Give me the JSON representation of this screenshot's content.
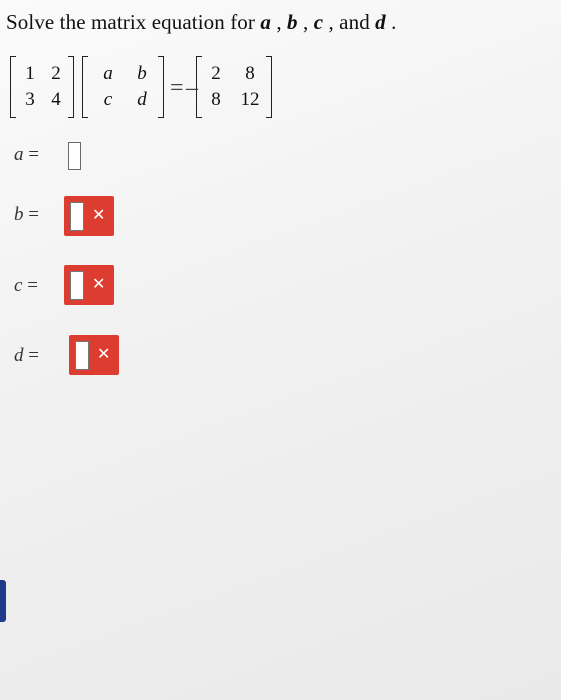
{
  "question": {
    "prefix": "Solve the matrix equation for ",
    "var_a": "a",
    "sep1": " , ",
    "var_b": "b",
    "sep2": " , ",
    "var_c": "c",
    "sep3": " , and ",
    "var_d": "d",
    "suffix": " ."
  },
  "equation": {
    "matrix_a": [
      [
        "1",
        "2"
      ],
      [
        "3",
        "4"
      ]
    ],
    "matrix_x": [
      [
        "a",
        "b"
      ],
      [
        "c",
        "d"
      ]
    ],
    "equals": "=",
    "minus": "–",
    "matrix_result": [
      [
        "2",
        "8"
      ],
      [
        "8",
        "12"
      ]
    ]
  },
  "answers": [
    {
      "var": "a",
      "eq": " =",
      "status": "empty"
    },
    {
      "var": "b",
      "eq": " =",
      "status": "incorrect"
    },
    {
      "var": "c",
      "eq": " =",
      "status": "incorrect"
    },
    {
      "var": "d",
      "eq": " =",
      "status": "incorrect"
    }
  ],
  "colors": {
    "incorrect_badge": "#dd3d31",
    "edge_mark": "#1f3a8a"
  },
  "icons": {
    "incorrect": "close-icon"
  },
  "icon_glyphs": {
    "close": "✕"
  }
}
